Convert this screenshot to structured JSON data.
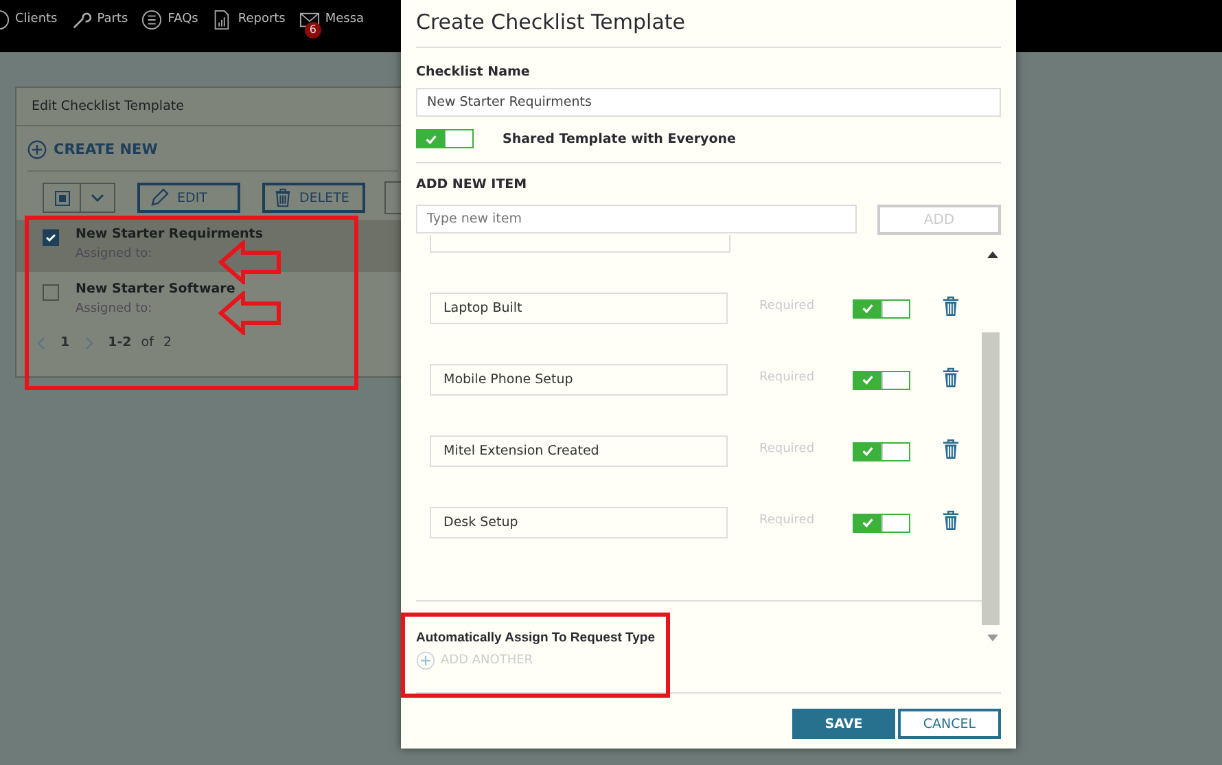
{
  "nav": [
    {
      "label": "Clients"
    },
    {
      "label": "Parts"
    },
    {
      "label": "FAQs"
    },
    {
      "label": "Reports"
    },
    {
      "label": "Messa",
      "badge": "6"
    }
  ],
  "panel": {
    "title": "Edit Checklist Template",
    "create": "CREATE NEW",
    "select_all_checked": true,
    "edit": "EDIT",
    "delete": "DELETE",
    "rows": [
      {
        "name": "New Starter Requirments",
        "sub": "Assigned to:",
        "selected": true
      },
      {
        "name": "New Starter Software",
        "sub": "Assigned to:",
        "selected": false
      }
    ],
    "pager": {
      "page": "1",
      "range": "1-2",
      "of": "of",
      "total": "2"
    }
  },
  "modal": {
    "title": "Create Checklist Template",
    "name_label": "Checklist Name",
    "name_value": "New Starter Requirments",
    "shared": {
      "label": "Shared Template with Everyone",
      "on": true
    },
    "add_label": "ADD NEW ITEM",
    "add_placeholder": "Type new item",
    "add_button": "ADD",
    "items": [
      {
        "name": "Laptop Built",
        "required": "Required",
        "on": true
      },
      {
        "name": "Mobile Phone Setup",
        "required": "Required",
        "on": true
      },
      {
        "name": "Mitel Extension Created",
        "required": "Required",
        "on": true
      },
      {
        "name": "Desk Setup",
        "required": "Required",
        "on": true
      }
    ],
    "assign_label": "Automatically Assign To Request Type",
    "add_another": "ADD ANOTHER",
    "save": "SAVE",
    "cancel": "CANCEL"
  }
}
